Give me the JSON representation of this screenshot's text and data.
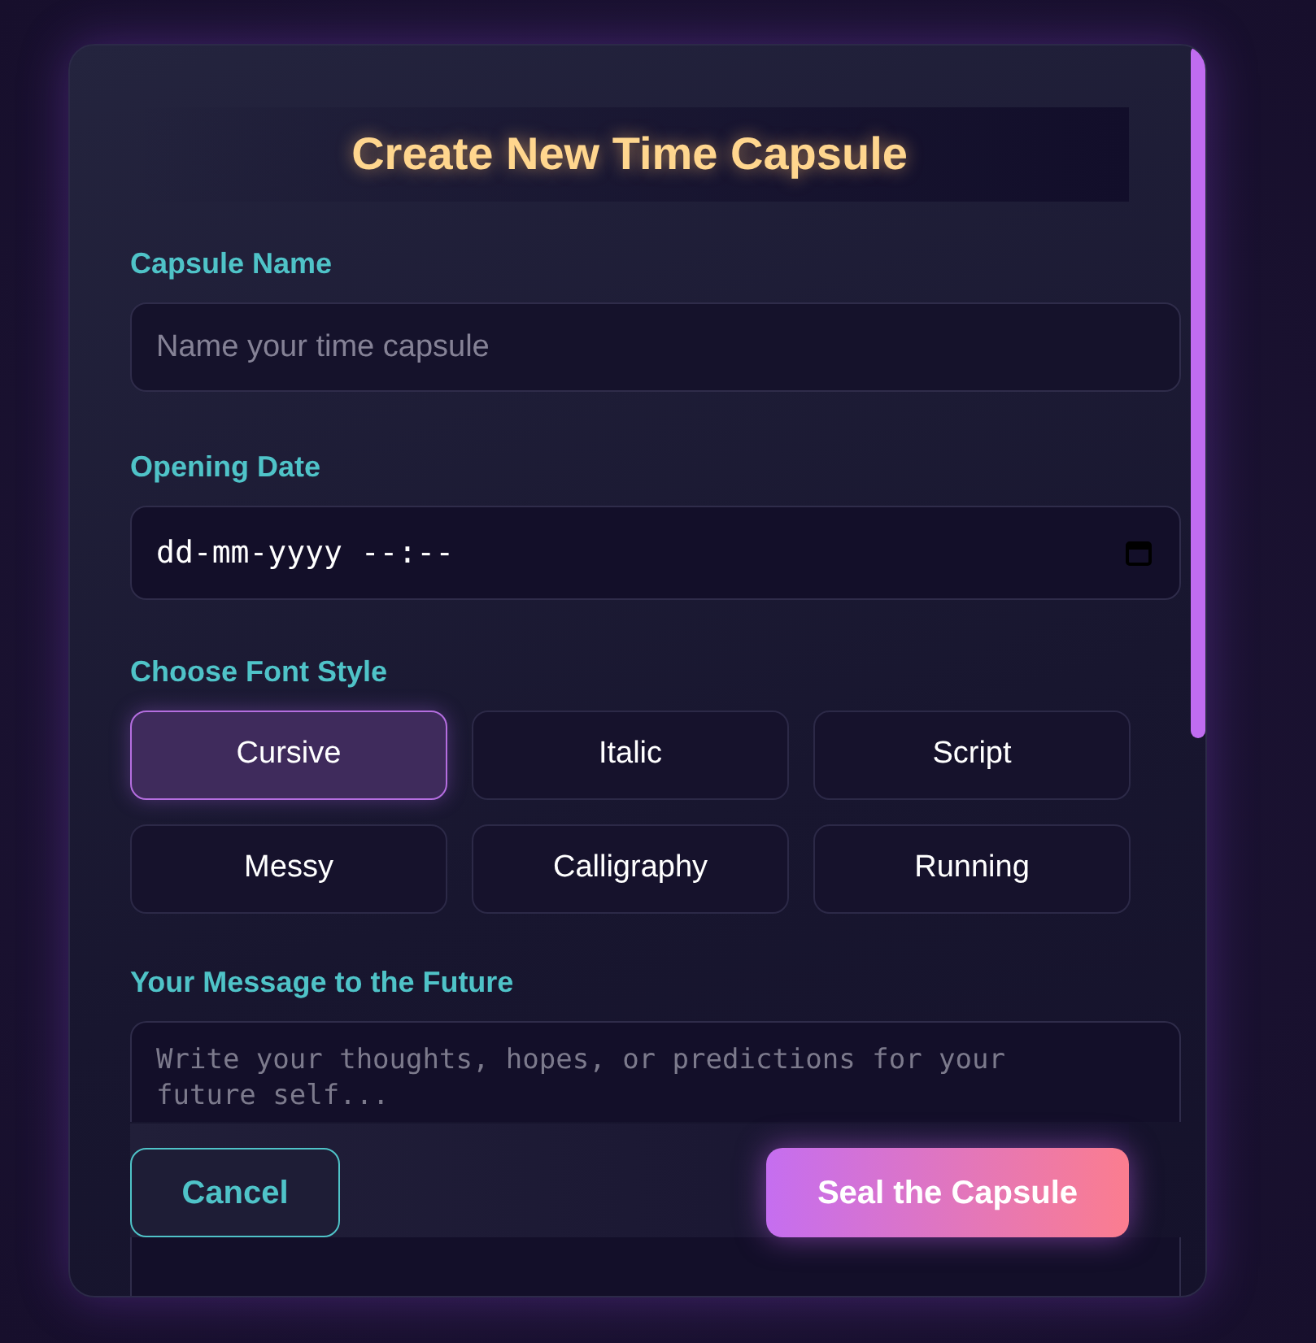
{
  "title": "Create New Time Capsule",
  "capsule_name": {
    "label": "Capsule Name",
    "placeholder": "Name your time capsule"
  },
  "opening_date": {
    "label": "Opening Date",
    "placeholder": "dd-mm-yyyy --:--"
  },
  "font_style": {
    "label": "Choose Font Style",
    "options": [
      {
        "label": "Cursive",
        "selected": true
      },
      {
        "label": "Italic",
        "selected": false
      },
      {
        "label": "Script",
        "selected": false
      },
      {
        "label": "Messy",
        "selected": false
      },
      {
        "label": "Calligraphy",
        "selected": false
      },
      {
        "label": "Running",
        "selected": false
      }
    ]
  },
  "message": {
    "label": "Your Message to the Future",
    "placeholder": "Write your thoughts, hopes, or predictions for your future self..."
  },
  "buttons": [
    {
      "label": "Cancel",
      "kind": "secondary"
    },
    {
      "label": "Seal the Capsule",
      "kind": "primary"
    }
  ]
}
